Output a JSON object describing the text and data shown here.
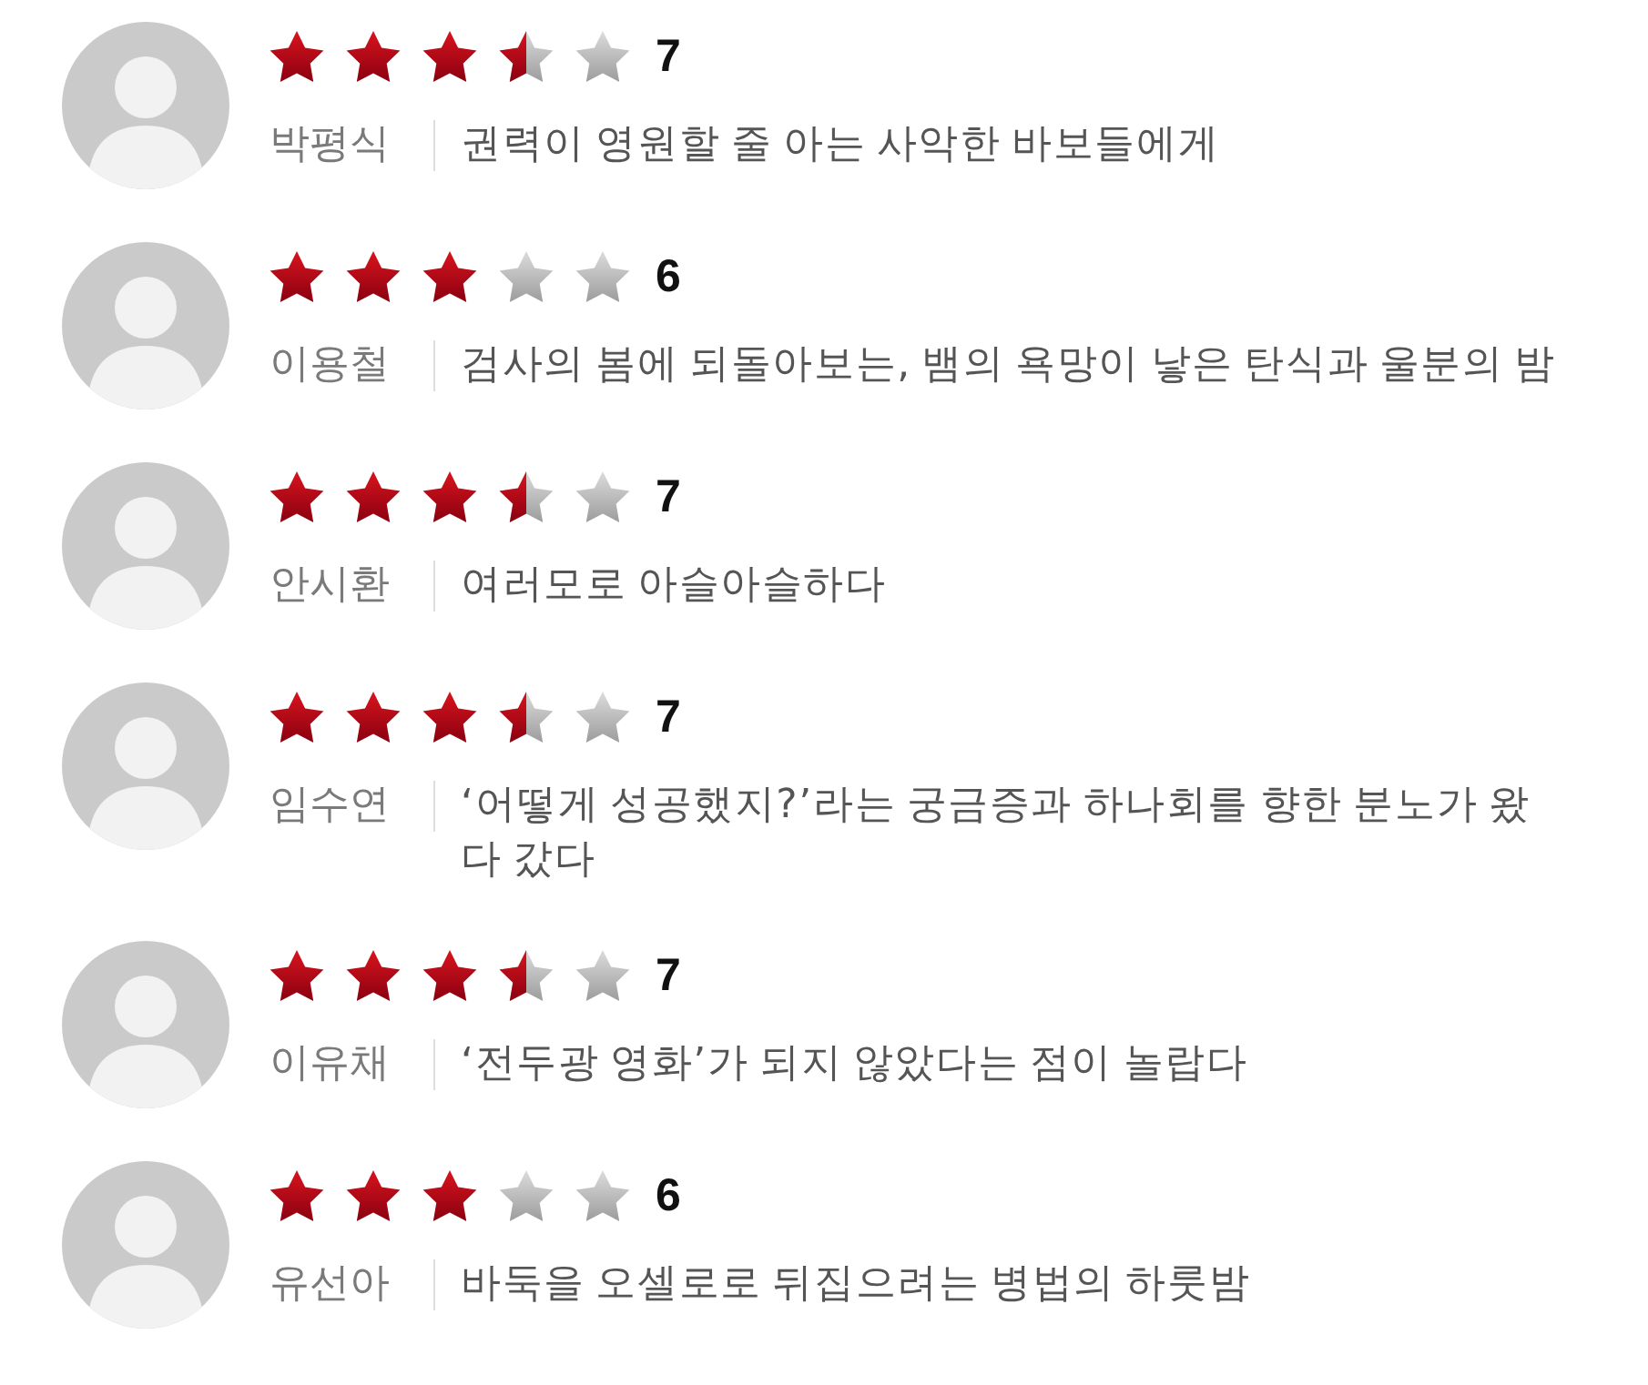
{
  "reviews": [
    {
      "stars": 3.5,
      "score": "7",
      "name": "박평식",
      "comment": "권력이 영원할 줄 아는 사악한 바보들에게"
    },
    {
      "stars": 3,
      "score": "6",
      "name": "이용철",
      "comment": "검사의 봄에 되돌아보는, 뱀의 욕망이 낳은 탄식과 울분의 밤"
    },
    {
      "stars": 3.5,
      "score": "7",
      "name": "안시환",
      "comment": "여러모로 아슬아슬하다"
    },
    {
      "stars": 3.5,
      "score": "7",
      "name": "임수연",
      "comment": "‘어떻게 성공했지?’라는 궁금증과 하나회를 향한 분노가 왔다 갔다"
    },
    {
      "stars": 3.5,
      "score": "7",
      "name": "이유채",
      "comment": "‘전두광 영화’가 되지 않았다는 점이 놀랍다"
    },
    {
      "stars": 3,
      "score": "6",
      "name": "유선아",
      "comment": "바둑을 오셀로로 뒤집으려는 병법의 하룻밤"
    }
  ]
}
